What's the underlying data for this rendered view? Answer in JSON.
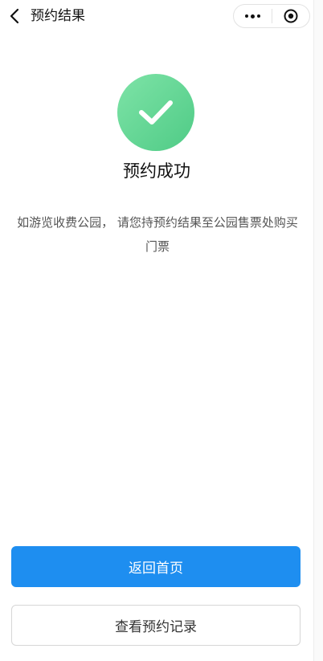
{
  "navbar": {
    "title": "预约结果",
    "back_icon": "chevron-left-icon",
    "more_icon": "more-dots-icon",
    "close_icon": "target-circle-icon"
  },
  "result": {
    "icon": "check-icon",
    "icon_color": "#5ad08f",
    "title": "预约成功",
    "notice": "如游览收费公园， 请您持预约结果至公园售票处购买门票"
  },
  "actions": {
    "home_label": "返回首页",
    "records_label": "查看预约记录",
    "primary_color": "#1e8ef0"
  }
}
